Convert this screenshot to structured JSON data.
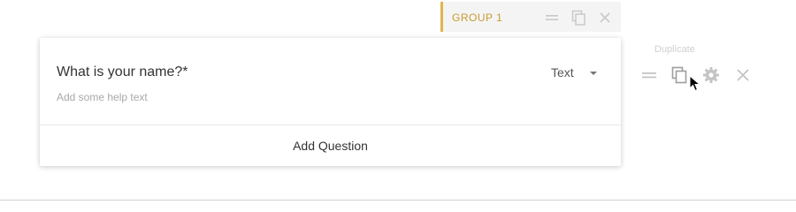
{
  "group": {
    "title": "GROUP 1",
    "accent_color": "#e2b44a",
    "icons": [
      "drag-handle-icon",
      "duplicate-icon",
      "close-icon"
    ]
  },
  "question": {
    "title": "What is your name?*",
    "help_placeholder": "Add some help text",
    "type": "Text"
  },
  "card": {
    "add_question_label": "Add Question"
  },
  "toolbar": {
    "tooltip": "Duplicate",
    "icons": [
      "drag-handle-icon",
      "duplicate-icon",
      "gear-icon",
      "close-icon"
    ]
  }
}
